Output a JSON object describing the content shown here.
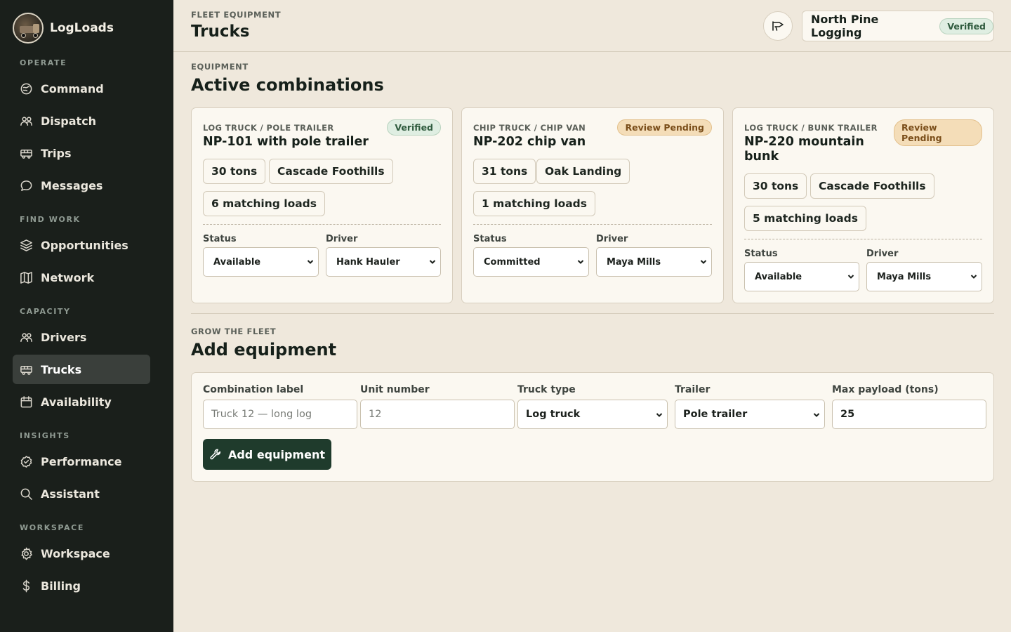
{
  "app": {
    "name": "LogLoads"
  },
  "sidebar": {
    "sections": [
      {
        "label": "OPERATE",
        "items": [
          {
            "label": "Command",
            "icon": "command-icon"
          },
          {
            "label": "Dispatch",
            "icon": "dispatch-icon"
          },
          {
            "label": "Trips",
            "icon": "truck-icon"
          },
          {
            "label": "Messages",
            "icon": "message-icon"
          }
        ]
      },
      {
        "label": "FIND WORK",
        "items": [
          {
            "label": "Opportunities",
            "icon": "layers-icon"
          },
          {
            "label": "Network",
            "icon": "map-icon"
          }
        ]
      },
      {
        "label": "CAPACITY",
        "items": [
          {
            "label": "Drivers",
            "icon": "users-icon"
          },
          {
            "label": "Trucks",
            "icon": "truck-icon",
            "active": true
          },
          {
            "label": "Availability",
            "icon": "calendar-icon"
          }
        ]
      },
      {
        "label": "INSIGHTS",
        "items": [
          {
            "label": "Performance",
            "icon": "badge-check-icon"
          },
          {
            "label": "Assistant",
            "icon": "search-icon"
          }
        ]
      },
      {
        "label": "WORKSPACE",
        "items": [
          {
            "label": "Workspace",
            "icon": "gear-icon"
          },
          {
            "label": "Billing",
            "icon": "dollar-icon"
          }
        ]
      }
    ]
  },
  "header": {
    "eyebrow": "FLEET EQUIPMENT",
    "title": "Trucks",
    "org_name": "North Pine Logging",
    "org_badge": "Verified"
  },
  "equipment": {
    "eyebrow": "EQUIPMENT",
    "title": "Active combinations",
    "status_label": "Status",
    "driver_label": "Driver",
    "cards": [
      {
        "type": "LOG TRUCK / POLE TRAILER",
        "title": "NP-101 with pole trailer",
        "badge": "Verified",
        "badge_kind": "verified",
        "payload": "30 tons",
        "region": "Cascade Foothills",
        "matches": "6 matching loads",
        "status": "Available",
        "driver": "Hank Hauler"
      },
      {
        "type": "CHIP TRUCK / CHIP VAN",
        "title": "NP-202 chip van",
        "badge": "Review Pending",
        "badge_kind": "pending",
        "payload": "31 tons",
        "region": "Oak Landing",
        "matches": "1 matching loads",
        "status": "Committed",
        "driver": "Maya Mills"
      },
      {
        "type": "LOG TRUCK / BUNK TRAILER",
        "title": "NP-220 mountain bunk",
        "badge": "Review Pending",
        "badge_kind": "pending",
        "payload": "30 tons",
        "region": "Cascade Foothills",
        "matches": "5 matching loads",
        "status": "Available",
        "driver": "Maya Mills"
      }
    ]
  },
  "add_form": {
    "eyebrow": "GROW THE FLEET",
    "title": "Add equipment",
    "fields": {
      "combination_label": {
        "label": "Combination label",
        "placeholder": "Truck 12 — long log",
        "value": ""
      },
      "unit_number": {
        "label": "Unit number",
        "placeholder": "12",
        "value": ""
      },
      "truck_type": {
        "label": "Truck type",
        "value": "Log truck"
      },
      "trailer": {
        "label": "Trailer",
        "value": "Pole trailer"
      },
      "max_payload": {
        "label": "Max payload (tons)",
        "value": "25"
      }
    },
    "submit_label": "Add equipment"
  }
}
